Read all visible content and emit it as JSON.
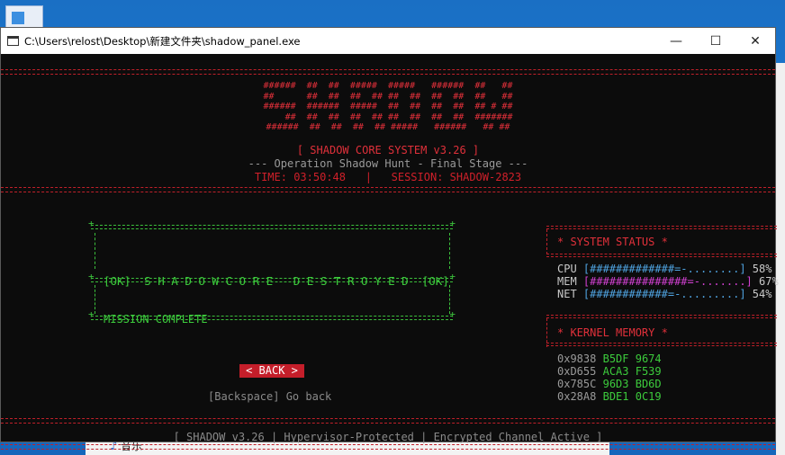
{
  "window": {
    "title": "C:\\Users\\relost\\Desktop\\新建文件夹\\shadow_panel.exe",
    "minimize": "—",
    "maximize": "☐",
    "close": "✕"
  },
  "taskbar": {
    "music_label": "音乐"
  },
  "banner": {
    "ascii_art": "######  ##  ##  #####  #####   ######  ##   ##\n##      ##  ##  ##  ## ##  ##  ##  ##  ##   ##\n######  ######  #####  ##  ##  ##  ##  ## # ##\n    ##  ##  ##  ##  ## ##  ##  ##  ##  #######\n######  ##  ##  ##  ## #####   ######   ## ##",
    "system_name": "[ SHADOW CORE SYSTEM v3.26 ]",
    "operation": "--- Operation Shadow Hunt - Final Stage ---",
    "time": "TIME: 03:50:48",
    "separator": "|",
    "session": "SESSION: SHADOW-2823"
  },
  "main": {
    "ok_left": "[OK]",
    "destroyed": "S H A D O W C O R E   D E S T R O Y E D",
    "ok_right": "[OK]",
    "mission": "MISSION COMPLETE",
    "back_button": "< BACK >",
    "hint": "[Backspace] Go back"
  },
  "status": {
    "title": "* SYSTEM STATUS *",
    "rows": [
      {
        "label": "CPU",
        "bar": "[#############=-........]",
        "percent": "58%",
        "color": "#4fa3e0"
      },
      {
        "label": "MEM",
        "bar": "[###############=-.......]",
        "percent": "67%",
        "color": "#d040d0"
      },
      {
        "label": "NET",
        "bar": "[############=-.........]",
        "percent": "54%",
        "color": "#4fa3e0"
      }
    ]
  },
  "memory": {
    "title": "* KERNEL MEMORY *",
    "rows": [
      {
        "addr": "0x9838",
        "hex": "B5DF 9674"
      },
      {
        "addr": "0xD655",
        "hex": "ACA3 F539"
      },
      {
        "addr": "0x785C",
        "hex": "96D3 BD6D"
      },
      {
        "addr": "0x28A8",
        "hex": "BDE1 0C19"
      }
    ]
  },
  "footer": "[ SHADOW v3.26 | Hypervisor-Protected | Encrypted Channel Active ]"
}
